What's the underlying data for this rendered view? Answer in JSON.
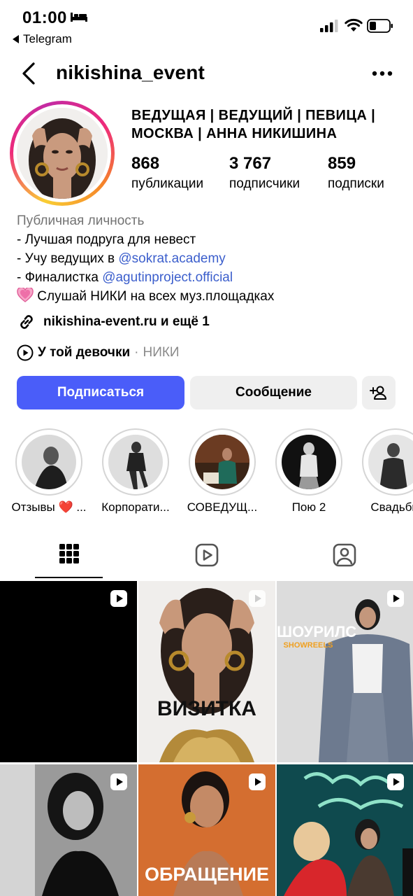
{
  "status_bar": {
    "time": "01:00",
    "back_app": "Telegram"
  },
  "header": {
    "username": "nikishina_event"
  },
  "profile": {
    "title": "ВЕДУЩАЯ | ВЕДУЩИЙ | ПЕВИЦА | МОСКВА | АННА НИКИШИНА",
    "stats": [
      {
        "value": "868",
        "label": "публикации"
      },
      {
        "value": "3 767",
        "label": "подписчики"
      },
      {
        "value": "859",
        "label": "подписки"
      }
    ],
    "category": "Публичная личность",
    "bio_line1": "- Лучшая подруга для невест",
    "bio_line2_prefix": "- Учу ведущих в ",
    "bio_line2_mention": "@sokrat.academy",
    "bio_line3_prefix": "- Финалистка ",
    "bio_line3_mention": "@agutinproject.official",
    "bio_line4": "Слушай НИКИ на всех муз.площадках",
    "link": "nikishina-event.ru и ещё 1",
    "music_song": "У той девочки",
    "music_sep": " · ",
    "music_artist": "НИКИ"
  },
  "buttons": {
    "follow": "Подписаться",
    "message": "Сообщение"
  },
  "highlights": [
    {
      "label": "Отзывы ❤️ ..."
    },
    {
      "label": "Корпорати..."
    },
    {
      "label": "СОВЕДУЩ..."
    },
    {
      "label": "Пою 2"
    },
    {
      "label": "Свадьбы"
    }
  ],
  "tabs": [
    "grid-tab",
    "reels-tab",
    "tagged-tab"
  ],
  "grid": {
    "tile2_text": "ВИЗИТКА",
    "tile3_text": "ШОУРИЛС",
    "tile3_subtext": "SHOWREELS",
    "tile5_text": "ОБРАЩЕНИЕ"
  },
  "colors": {
    "follow_button": "#4a5df9",
    "mention": "#3b5ecc",
    "secondary_button": "#efefef"
  }
}
